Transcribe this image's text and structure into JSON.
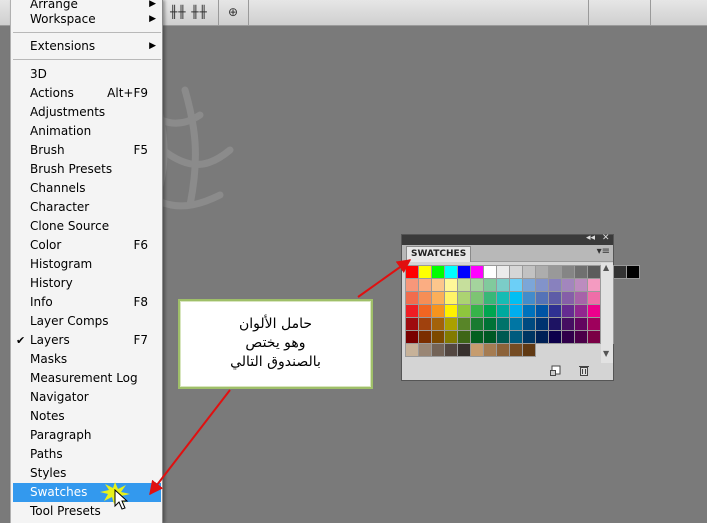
{
  "menu": {
    "top_items": [
      {
        "label": "Arrange",
        "submenu": true
      },
      {
        "label": "Workspace",
        "submenu": true
      }
    ],
    "extensions": {
      "label": "Extensions",
      "submenu": true
    },
    "items": [
      {
        "label": "3D",
        "shortcut": "",
        "checked": false
      },
      {
        "label": "Actions",
        "shortcut": "Alt+F9",
        "checked": false
      },
      {
        "label": "Adjustments",
        "shortcut": "",
        "checked": false
      },
      {
        "label": "Animation",
        "shortcut": "",
        "checked": false
      },
      {
        "label": "Brush",
        "shortcut": "F5",
        "checked": false
      },
      {
        "label": "Brush Presets",
        "shortcut": "",
        "checked": false
      },
      {
        "label": "Channels",
        "shortcut": "",
        "checked": false
      },
      {
        "label": "Character",
        "shortcut": "",
        "checked": false
      },
      {
        "label": "Clone Source",
        "shortcut": "",
        "checked": false
      },
      {
        "label": "Color",
        "shortcut": "F6",
        "checked": false
      },
      {
        "label": "Histogram",
        "shortcut": "",
        "checked": false
      },
      {
        "label": "History",
        "shortcut": "",
        "checked": false
      },
      {
        "label": "Info",
        "shortcut": "F8",
        "checked": false
      },
      {
        "label": "Layer Comps",
        "shortcut": "",
        "checked": false
      },
      {
        "label": "Layers",
        "shortcut": "F7",
        "checked": true
      },
      {
        "label": "Masks",
        "shortcut": "",
        "checked": false
      },
      {
        "label": "Measurement Log",
        "shortcut": "",
        "checked": false
      },
      {
        "label": "Navigator",
        "shortcut": "",
        "checked": false
      },
      {
        "label": "Notes",
        "shortcut": "",
        "checked": false
      },
      {
        "label": "Paragraph",
        "shortcut": "",
        "checked": false
      },
      {
        "label": "Paths",
        "shortcut": "",
        "checked": false
      },
      {
        "label": "Styles",
        "shortcut": "",
        "checked": false
      },
      {
        "label": "Swatches",
        "shortcut": "",
        "checked": false,
        "highlighted": true
      },
      {
        "label": "Tool Presets",
        "shortcut": "",
        "checked": false
      }
    ],
    "check_glyph": "✔",
    "highlight_color": "#3399ee"
  },
  "swatches_panel": {
    "tab_label": "SWATCHES",
    "collapse_glyph": "◂◂",
    "close_glyph": "✕",
    "menu_glyph": "▾≡",
    "new_icon": "new-swatch-icon",
    "delete_icon": "trash-icon",
    "rows": [
      [
        "#ff0000",
        "#ffff00",
        "#00ff00",
        "#00ffff",
        "#0000ff",
        "#ff00ff",
        "#ffffff",
        "#ebebeb",
        "#d6d6d6",
        "#c2c2c2",
        "#adadad",
        "#999999",
        "#858585",
        "#707070",
        "#5c5c5c",
        "#474747",
        "#333333",
        "#000000"
      ],
      [
        "#f7977a",
        "#fbad82",
        "#fdc68c",
        "#fff799",
        "#c6df9c",
        "#a4d49d",
        "#81ca9d",
        "#7bcdc8",
        "#6ccff7",
        "#7ca6d8",
        "#8293ca",
        "#8881be",
        "#a286bd",
        "#bc8cbf",
        "#f49bc1",
        "#f5999d"
      ],
      [
        "#f16c4d",
        "#f68e56",
        "#fbaf5a",
        "#fff467",
        "#acd372",
        "#7dc473",
        "#39b778",
        "#16bcb4",
        "#00bff3",
        "#438ccb",
        "#5573b7",
        "#5e5ca7",
        "#855fa8",
        "#a763a9",
        "#ef6ea8",
        "#f16d7e"
      ],
      [
        "#ee1d24",
        "#f16522",
        "#f7941d",
        "#fff100",
        "#8fc63d",
        "#37b44a",
        "#00a650",
        "#00a99e",
        "#00aeef",
        "#0072bc",
        "#0054a5",
        "#2f3192",
        "#652c91",
        "#91278f",
        "#ec008c",
        "#ed1651"
      ],
      [
        "#9e0b0f",
        "#a0410d",
        "#a3620a",
        "#aba000",
        "#588528",
        "#197b30",
        "#007236",
        "#00736a",
        "#0076a4",
        "#004a80",
        "#003370",
        "#1d1363",
        "#450e61",
        "#62055f",
        "#9e005c",
        "#9d0039"
      ],
      [
        "#790000",
        "#7b2e00",
        "#7d4900",
        "#827a00",
        "#3e6617",
        "#045f20",
        "#005824",
        "#005951",
        "#005b7e",
        "#003562",
        "#002056",
        "#0c004b",
        "#30004a",
        "#4b0048",
        "#7a0045",
        "#7a0026"
      ],
      [
        "#c7b299",
        "#998675",
        "#736357",
        "#534741",
        "#37302d",
        "#c69c6e",
        "#a57c52",
        "#8c6239",
        "#754c24",
        "#603913"
      ]
    ]
  },
  "annotation": {
    "lines": [
      "حامل الألوان",
      "وهو يختص",
      "بالصندوق التالي"
    ]
  }
}
